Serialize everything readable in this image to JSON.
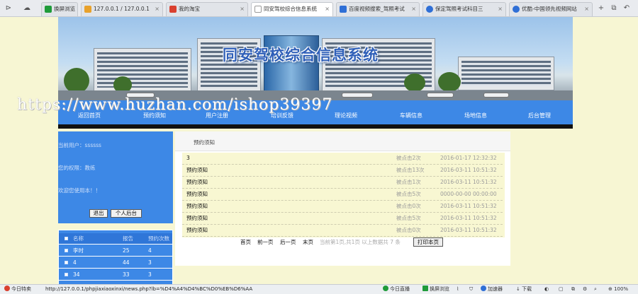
{
  "browser": {
    "tabs": [
      {
        "label": "换屏浏览"
      },
      {
        "label": "127.0.0.1 / 127.0.0.1"
      },
      {
        "label": "我的淘宝"
      },
      {
        "label": "同安驾校综合信息系统"
      },
      {
        "label": "百度视频搜索_驾照考试"
      },
      {
        "label": "保定驾照考试科目三"
      },
      {
        "label": "优酷-中国领先视频网站"
      }
    ],
    "colors": {
      "tab_green": "#1f9b3a",
      "tab_orange": "#e8a12b",
      "tab_red": "#d9402f",
      "tab_blue": "#2f6fd6"
    }
  },
  "site": {
    "title": "同安驾校综合信息系统",
    "watermark": "https://www.huzhan.com/ishop39397",
    "nav": [
      "返回首页",
      "预约须知",
      "用户注册",
      "培训反馈",
      "理论视频",
      "车辆信息",
      "场地信息",
      "后台管理"
    ],
    "accent_color": "#3d88e6"
  },
  "user": {
    "current_user_label": "当前用户：ssssss",
    "role_label": "您的权限：教练",
    "welcome": "欢迎您使用本！！",
    "logout_button": "退出",
    "personal_button": "个人后台"
  },
  "ranking": {
    "headers": [
      "名称",
      "报告",
      "预约次数"
    ],
    "rows": [
      {
        "name": "李时",
        "value": "25",
        "count": "4"
      },
      {
        "name": "4",
        "value": "44",
        "count": "3"
      },
      {
        "name": "34",
        "value": "33",
        "count": "3"
      }
    ]
  },
  "notices": {
    "heading": "预约须知",
    "items": [
      {
        "title": "3",
        "clicks": "被点击2次",
        "time": "2016-01-17 12:32:32"
      },
      {
        "title": "预约须知",
        "clicks": "被点击13次",
        "time": "2016-03-11 10:51:32"
      },
      {
        "title": "预约须知",
        "clicks": "被点击1次",
        "time": "2016-03-11 10:51:32"
      },
      {
        "title": "预约须知",
        "clicks": "被点击5次",
        "time": "0000-00-00 00:00:00"
      },
      {
        "title": "预约须知",
        "clicks": "被点击0次",
        "time": "2016-03-11 10:51:32"
      },
      {
        "title": "预约须知",
        "clicks": "被点击5次",
        "time": "2016-03-11 10:51:32"
      },
      {
        "title": "预约须知",
        "clicks": "被点击0次",
        "time": "2016-03-11 10:51:32"
      }
    ],
    "pager": {
      "first": "首页",
      "prev": "前一页",
      "next": "后一页",
      "last": "末页",
      "info": "当前第1页,共1页 以上数据共 7 条",
      "print": "打印本页"
    }
  },
  "status": {
    "left": "今日特卖",
    "url": "http://127.0.0.1/phpjiaxiaoxinxi/news.php?lb=%D4%A4%D4%BC%D0%EB%D6%AA",
    "live": "今日直播",
    "split": "换屏浏览",
    "speed": "加速器",
    "download": "下载",
    "zoom": "100%"
  }
}
